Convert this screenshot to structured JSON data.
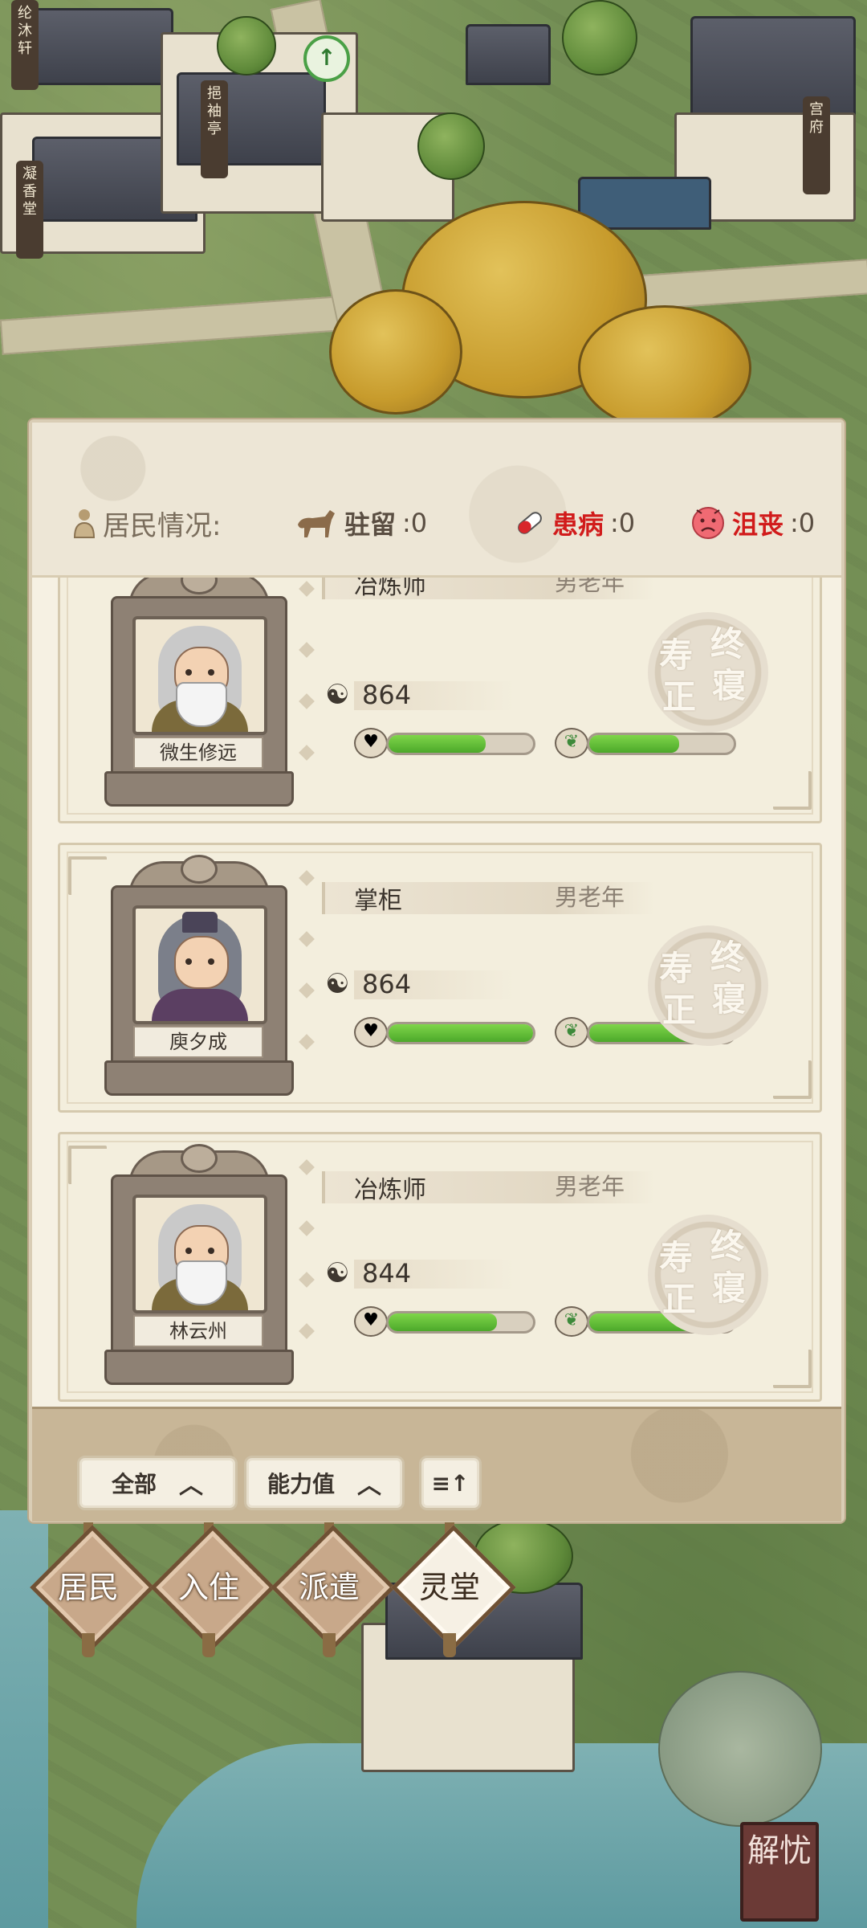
{
  "scene": {
    "signs": [
      "纶沐轩",
      "挹袖亭",
      "凝香堂",
      "宫府"
    ],
    "map_marker": "↑"
  },
  "panel": {
    "status": {
      "title": "居民情况:",
      "stationed": {
        "label": "驻留",
        "value": ":0"
      },
      "sick": {
        "label": "患病",
        "value": ":0"
      },
      "depressed": {
        "label": "沮丧",
        "value": ":0"
      }
    },
    "residents": [
      {
        "role": "冶炼师",
        "tag": "男老年",
        "name": "微生修远",
        "age": "864",
        "health": 0.67,
        "spirit": 0.62,
        "stamp": [
          "寿",
          "终",
          "正",
          "寝"
        ]
      },
      {
        "role": "掌柜",
        "tag": "男老年",
        "name": "庾夕成",
        "age": "864",
        "health": 1.0,
        "spirit": 1.0,
        "stamp": [
          "寿",
          "终",
          "正",
          "寝"
        ]
      },
      {
        "role": "冶炼师",
        "tag": "男老年",
        "name": "林云州",
        "age": "844",
        "health": 0.75,
        "spirit": 0.95,
        "stamp": [
          "寿",
          "终",
          "正",
          "寝"
        ]
      }
    ],
    "filters": {
      "all": "全部",
      "ability": "能力值",
      "sort_icon": "≡↑"
    }
  },
  "nav": {
    "items": [
      "居民",
      "入住",
      "派遣",
      "灵堂"
    ],
    "active": 3
  },
  "seal": "解忧"
}
